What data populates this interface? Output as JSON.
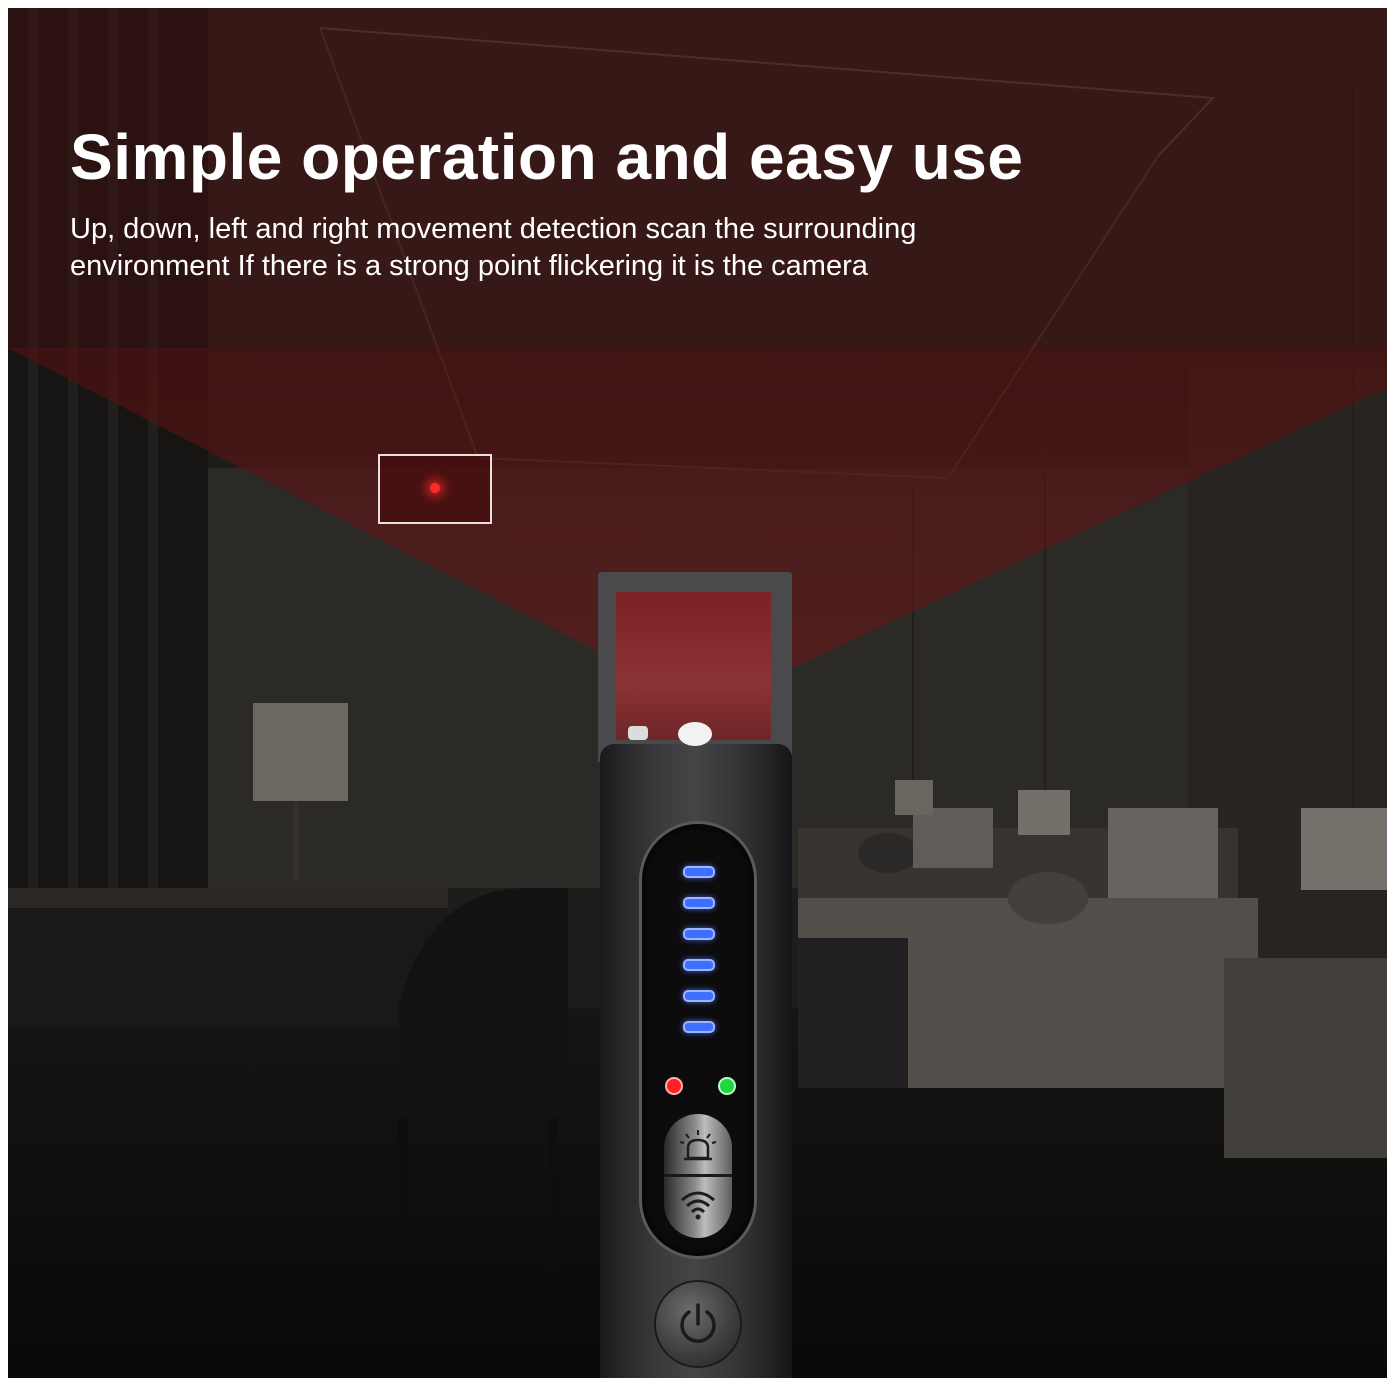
{
  "banner": {
    "headline": "Simple operation and easy use",
    "description_line1": "Up, down, left and right movement detection scan the surrounding",
    "description_line2": "environment If there is a strong point flickering it is the camera"
  },
  "scene": {
    "setting": "dark hotel bedroom",
    "scan_beam_color": "#7a1a1a",
    "detected_point_color": "#ff2a2a"
  },
  "device": {
    "signal_led_count": 6,
    "signal_led_color": "#3f6fff",
    "status_lights": [
      "red",
      "green"
    ],
    "icons": [
      "alarm-icon",
      "wifi-signal-icon",
      "power-icon"
    ]
  }
}
